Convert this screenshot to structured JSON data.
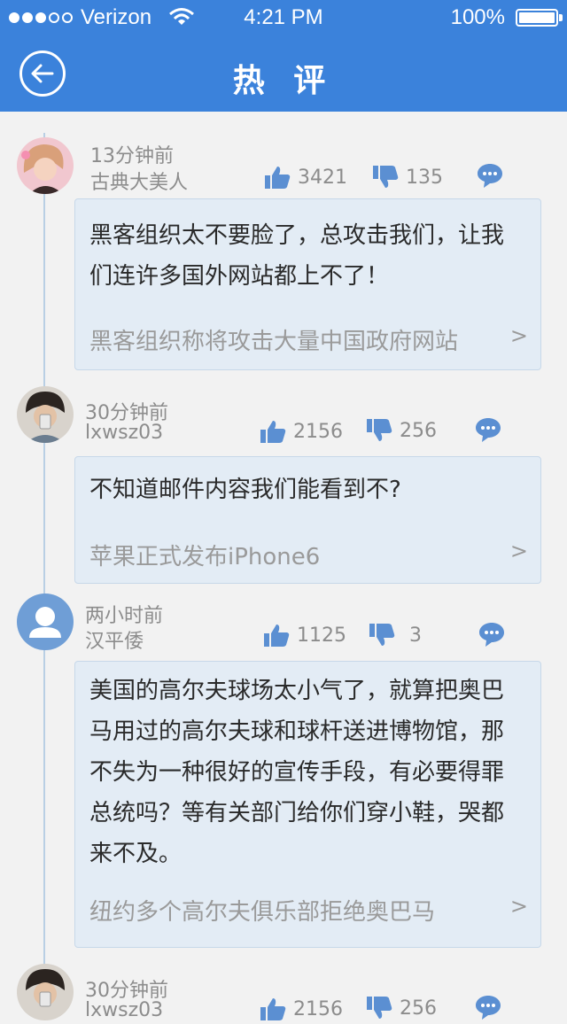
{
  "status_bar": {
    "carrier": "Verizon",
    "time": "4:21 PM",
    "battery": "100%",
    "signal_bars_on": 3,
    "signal_bars_total": 5
  },
  "header": {
    "title": "热 评",
    "background_color": "#3b82db"
  },
  "comments": [
    {
      "time": "13分钟前",
      "user": "古典大美人",
      "likes": "3421",
      "dislikes": "135",
      "text": "黑客组织太不要脸了，总攻击我们，让我们连许多国外网站都上不了！",
      "news_title": "黑客组织称将攻击大量中国政府网站",
      "chevron": ">"
    },
    {
      "time": "30分钟前",
      "user": "lxwsz03",
      "likes": "2156",
      "dislikes": "256",
      "text": "不知道邮件内容我们能看到不?",
      "news_title": "苹果正式发布iPhone6",
      "chevron": ">"
    },
    {
      "time": "两小时前",
      "user": "汉平倭",
      "likes": "1125",
      "dislikes": "3",
      "text": "美国的高尔夫球场太小气了，就算把奥巴马用过的高尔夫球和球杆送进博物馆，那不失为一种很好的宣传手段，有必要得罪总统吗？等有关部门给你们穿小鞋，哭都来不及。",
      "news_title": "纽约多个高尔夫俱乐部拒绝奥巴马",
      "chevron": ">"
    },
    {
      "time": "30分钟前",
      "user": "lxwsz03",
      "likes": "2156",
      "dislikes": "256"
    }
  ],
  "icons": {
    "back": "back-arrow-icon",
    "like": "thumbs-up-icon",
    "dislike": "thumbs-down-icon",
    "reply": "comment-bubble-icon"
  },
  "colors": {
    "accent": "#3b82db",
    "icon": "#5b8fd2",
    "card_bg": "#e3ecf5",
    "muted_text": "#8c8c8c"
  }
}
